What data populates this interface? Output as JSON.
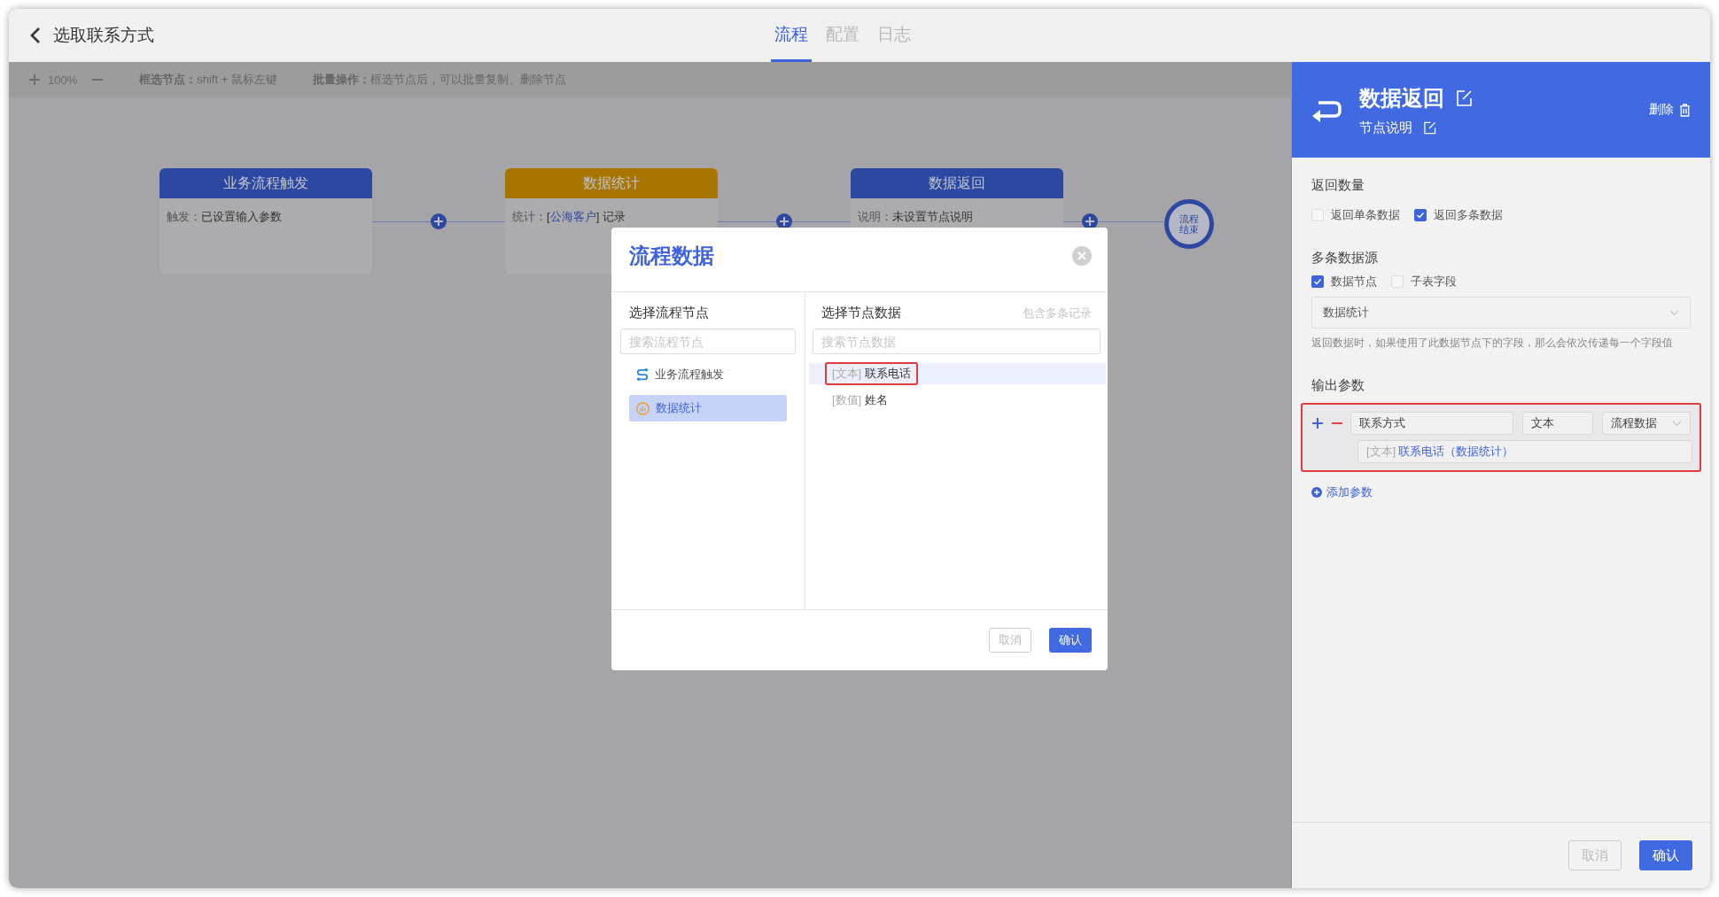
{
  "header": {
    "title": "选取联系方式"
  },
  "tabs": [
    {
      "label": "流程",
      "selected": true
    },
    {
      "label": "配置",
      "selected": false
    },
    {
      "label": "日志",
      "selected": false
    }
  ],
  "toolbar": {
    "zoom": "100%",
    "hints": [
      "**框选节点：**shift + 鼠标左键",
      "**批量操作：**框选节点后，可以批量复制、删除节点"
    ]
  },
  "nodes": [
    {
      "title": "业务流程触发",
      "color": "#2c48a0",
      "body": [
        {
          "kind": "label",
          "text": "触发："
        },
        {
          "kind": "value",
          "text": "已设置输入参数"
        }
      ]
    },
    {
      "title": "数据统计",
      "color": "#a87500",
      "body": [
        {
          "kind": "label",
          "text": "统计："
        },
        {
          "kind": "value",
          "text": "["
        },
        {
          "kind": "link",
          "text": "公海客户"
        },
        {
          "kind": "value",
          "text": "] 记录"
        }
      ]
    },
    {
      "title": "数据返回",
      "color": "#2c48a0",
      "body": [
        {
          "kind": "label",
          "text": "说明："
        },
        {
          "kind": "value",
          "text": "未设置节点说明"
        }
      ]
    }
  ],
  "end_node": "流程结束",
  "dialog": {
    "title": "流程数据",
    "left": {
      "heading": "选择流程节点",
      "placeholder": "搜索流程节点",
      "items": [
        {
          "kind": "flow",
          "label": "业务流程触发",
          "selected": false
        },
        {
          "kind": "chart",
          "label": "数据统计",
          "selected": true
        }
      ]
    },
    "right": {
      "heading": "选择节点数据",
      "note": "包含多条记录",
      "placeholder": "搜索节点数据",
      "items": [
        {
          "type": "[文本]",
          "label": "联系电话",
          "selected": true,
          "highlighted": true
        },
        {
          "type": "[数值]",
          "label": "姓名",
          "selected": false,
          "highlighted": false
        }
      ]
    },
    "buttons": [
      {
        "kind": "secondary",
        "label": "取消"
      },
      {
        "kind": "primary",
        "label": "确认"
      }
    ]
  },
  "panel": {
    "title": "数据返回",
    "subtitle": "节点说明",
    "delete_label": "删除",
    "return_count": {
      "label": "返回数量",
      "options": [
        {
          "label": "返回单条数据",
          "checked": false
        },
        {
          "label": "返回多条数据",
          "checked": true
        }
      ]
    },
    "source": {
      "label": "多条数据源",
      "options": [
        {
          "label": "数据节点",
          "checked": true
        },
        {
          "label": "子表字段",
          "checked": false
        }
      ],
      "select_value": "数据统计",
      "hint": "返回数据时，如果使用了此数据节点下的字段，那么会依次传递每一个字段值"
    },
    "output": {
      "label": "输出参数",
      "params": [
        {
          "name": "联系方式",
          "type": "文本",
          "source": "流程数据",
          "value_type": "[文本]",
          "value": "联系电话（数据统计）",
          "highlighted": true
        }
      ],
      "add_label": "添加参数"
    },
    "buttons": [
      {
        "kind": "secondary",
        "label": "取消"
      },
      {
        "kind": "primary",
        "label": "确认"
      }
    ]
  }
}
